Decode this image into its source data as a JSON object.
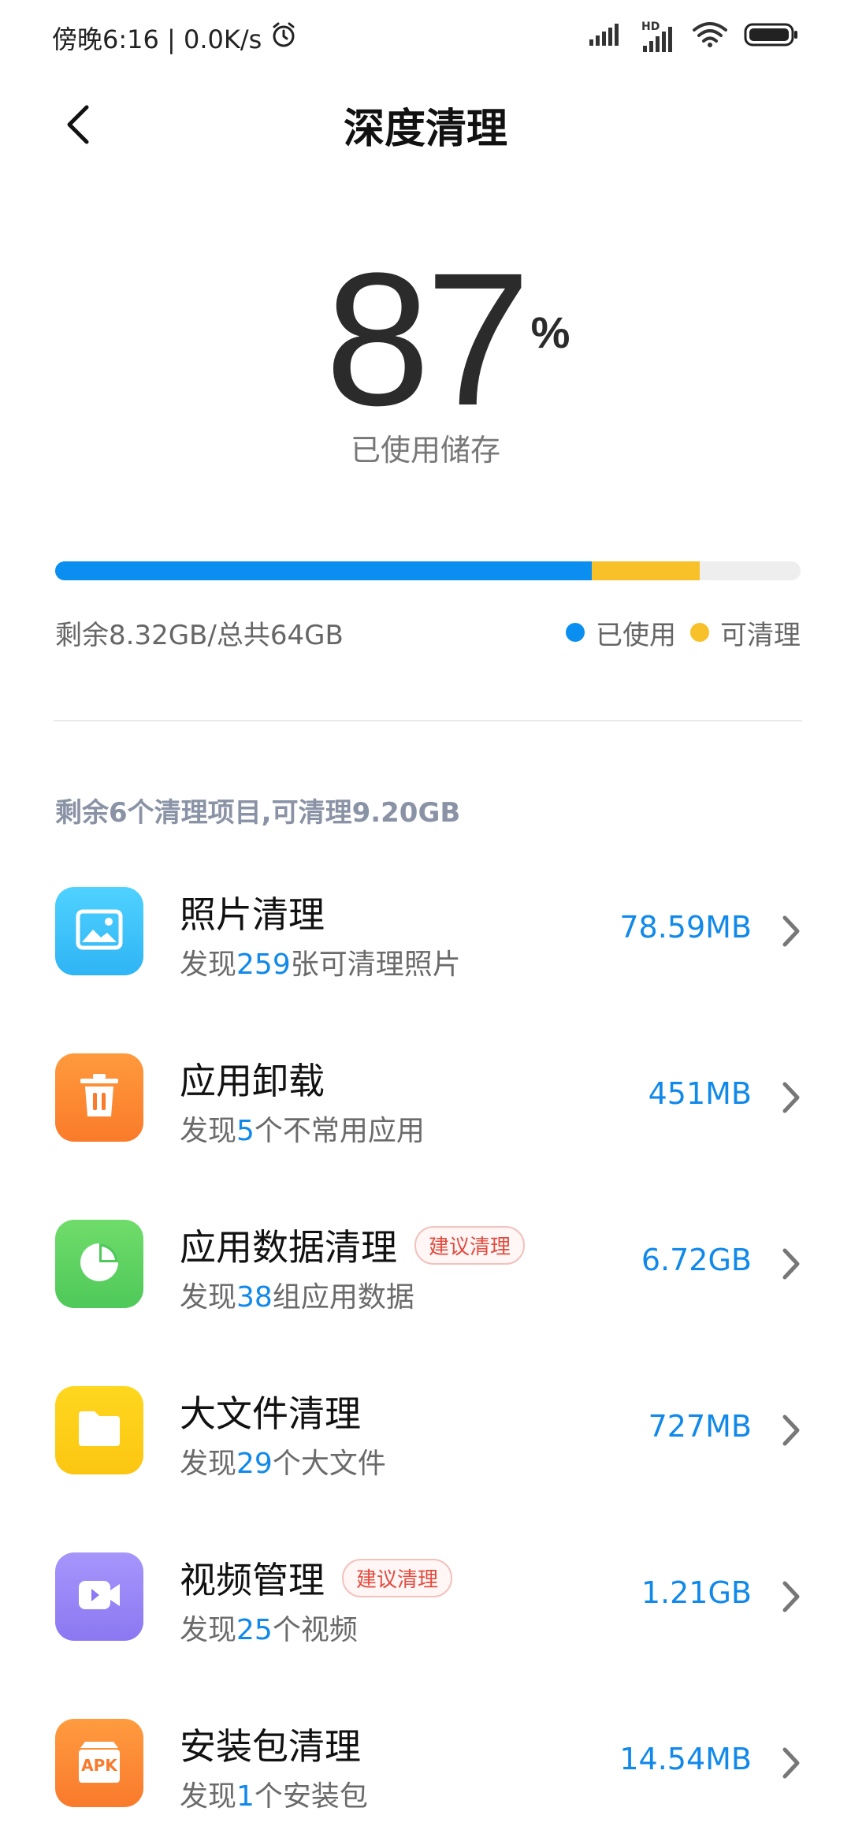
{
  "status_bar": {
    "time_speed": "傍晚6:16 | 0.0K/s",
    "network_label": "HD"
  },
  "header": {
    "title": "深度清理"
  },
  "usage": {
    "percent_value": "87",
    "percent_sign": "%",
    "label": "已使用储存",
    "used_fraction": 0.72,
    "cleanable_fraction": 0.145
  },
  "storage": {
    "summary": "剩余8.32GB/总共64GB",
    "legend_used": "已使用",
    "legend_cleanable": "可清理"
  },
  "colors": {
    "used": "#0a8ef0",
    "cleanable": "#f8c12a",
    "accent_text": "#1189ea"
  },
  "summary_text": "剩余6个清理项目,可清理9.20GB",
  "items": [
    {
      "icon": "photo-icon",
      "title": "照片清理",
      "badge": "",
      "sub_prefix": "发现",
      "sub_num": "259",
      "sub_suffix": "张可清理照片",
      "size": "78.59MB"
    },
    {
      "icon": "trash-icon",
      "title": "应用卸载",
      "badge": "",
      "sub_prefix": "发现",
      "sub_num": "5",
      "sub_suffix": "个不常用应用",
      "size": "451MB"
    },
    {
      "icon": "pie-chart-icon",
      "title": "应用数据清理",
      "badge": "建议清理",
      "sub_prefix": "发现",
      "sub_num": "38",
      "sub_suffix": "组应用数据",
      "size": "6.72GB"
    },
    {
      "icon": "folder-icon",
      "title": "大文件清理",
      "badge": "",
      "sub_prefix": "发现",
      "sub_num": "29",
      "sub_suffix": "个大文件",
      "size": "727MB"
    },
    {
      "icon": "video-icon",
      "title": "视频管理",
      "badge": "建议清理",
      "sub_prefix": "发现",
      "sub_num": "25",
      "sub_suffix": "个视频",
      "size": "1.21GB"
    },
    {
      "icon": "apk-icon",
      "title": "安装包清理",
      "badge": "",
      "sub_prefix": "发现",
      "sub_num": "1",
      "sub_suffix": "个安装包",
      "size": "14.54MB"
    }
  ],
  "apk_label": "APK"
}
